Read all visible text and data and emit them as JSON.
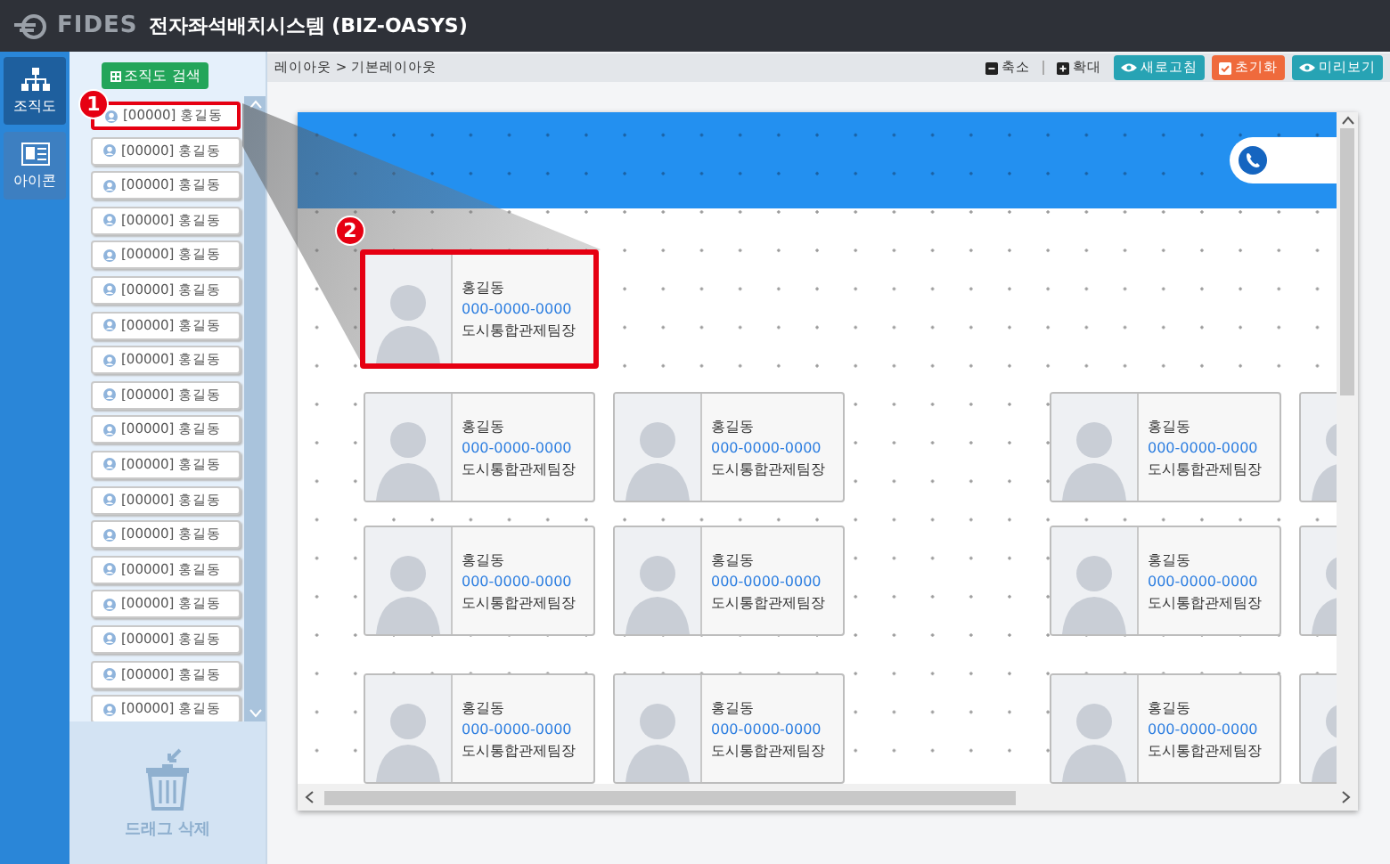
{
  "header": {
    "logo": "FIDES",
    "title": "전자좌석배치시스템 (BIZ-OASYS)"
  },
  "rail": [
    {
      "label": "조직도",
      "kind": "tree",
      "selected": true
    },
    {
      "label": "아이콘",
      "kind": "card",
      "selected": false
    }
  ],
  "panel": {
    "search_button": "조직도 검색",
    "trash_label": "드래그 삭제",
    "items": [
      {
        "label": "[00000] 홍길동",
        "highlighted": true
      },
      {
        "label": "[00000] 홍길동",
        "highlighted": false
      },
      {
        "label": "[00000] 홍길동",
        "highlighted": false
      },
      {
        "label": "[00000] 홍길동",
        "highlighted": false
      },
      {
        "label": "[00000] 홍길동",
        "highlighted": false
      },
      {
        "label": "[00000] 홍길동",
        "highlighted": false
      },
      {
        "label": "[00000] 홍길동",
        "highlighted": false
      },
      {
        "label": "[00000] 홍길동",
        "highlighted": false
      },
      {
        "label": "[00000] 홍길동",
        "highlighted": false
      },
      {
        "label": "[00000] 홍길동",
        "highlighted": false
      },
      {
        "label": "[00000] 홍길동",
        "highlighted": false
      },
      {
        "label": "[00000] 홍길동",
        "highlighted": false
      },
      {
        "label": "[00000] 홍길동",
        "highlighted": false
      },
      {
        "label": "[00000] 홍길동",
        "highlighted": false
      },
      {
        "label": "[00000] 홍길동",
        "highlighted": false
      },
      {
        "label": "[00000] 홍길동",
        "highlighted": false
      },
      {
        "label": "[00000] 홍길동",
        "highlighted": false
      },
      {
        "label": "[00000] 홍길동",
        "highlighted": false
      }
    ]
  },
  "breadcrumb": "레이아웃 > 기본레이아웃",
  "toolbar": [
    {
      "label": "축소",
      "kind": "zoom_out"
    },
    {
      "label": "확대",
      "kind": "zoom_in"
    },
    {
      "label": "새로고침",
      "kind": "refresh"
    },
    {
      "label": "초기화",
      "kind": "reset"
    },
    {
      "label": "미리보기",
      "kind": "preview"
    }
  ],
  "callouts": [
    "1",
    "2"
  ],
  "cards": [
    {
      "kind": "full",
      "name": "홍길동",
      "phone": "000-0000-0000",
      "title": "도시통합관제팀장",
      "highlighted": true
    },
    {
      "kind": "full",
      "name": "홍길동",
      "phone": "000-0000-0000",
      "title": "도시통합관제팀장",
      "highlighted": false
    },
    {
      "kind": "full",
      "name": "홍길동",
      "phone": "000-0000-0000",
      "title": "도시통합관제팀장",
      "highlighted": false
    },
    {
      "kind": "full",
      "name": "홍길동",
      "phone": "000-0000-0000",
      "title": "도시통합관제팀장",
      "highlighted": false
    },
    {
      "kind": "photo_only",
      "highlighted": false
    },
    {
      "kind": "full",
      "name": "홍길동",
      "phone": "000-0000-0000",
      "title": "도시통합관제팀장",
      "highlighted": false
    },
    {
      "kind": "full",
      "name": "홍길동",
      "phone": "000-0000-0000",
      "title": "도시통합관제팀장",
      "highlighted": false
    },
    {
      "kind": "full",
      "name": "홍길동",
      "phone": "000-0000-0000",
      "title": "도시통합관제팀장",
      "highlighted": false
    },
    {
      "kind": "photo_only",
      "highlighted": false
    },
    {
      "kind": "full",
      "name": "홍길동",
      "phone": "000-0000-0000",
      "title": "도시통합관제팀장",
      "highlighted": false
    },
    {
      "kind": "full",
      "name": "홍길동",
      "phone": "000-0000-0000",
      "title": "도시통합관제팀장",
      "highlighted": false
    },
    {
      "kind": "full",
      "name": "홍길동",
      "phone": "000-0000-0000",
      "title": "도시통합관제팀장",
      "highlighted": false
    },
    {
      "kind": "photo_only",
      "highlighted": false
    }
  ]
}
